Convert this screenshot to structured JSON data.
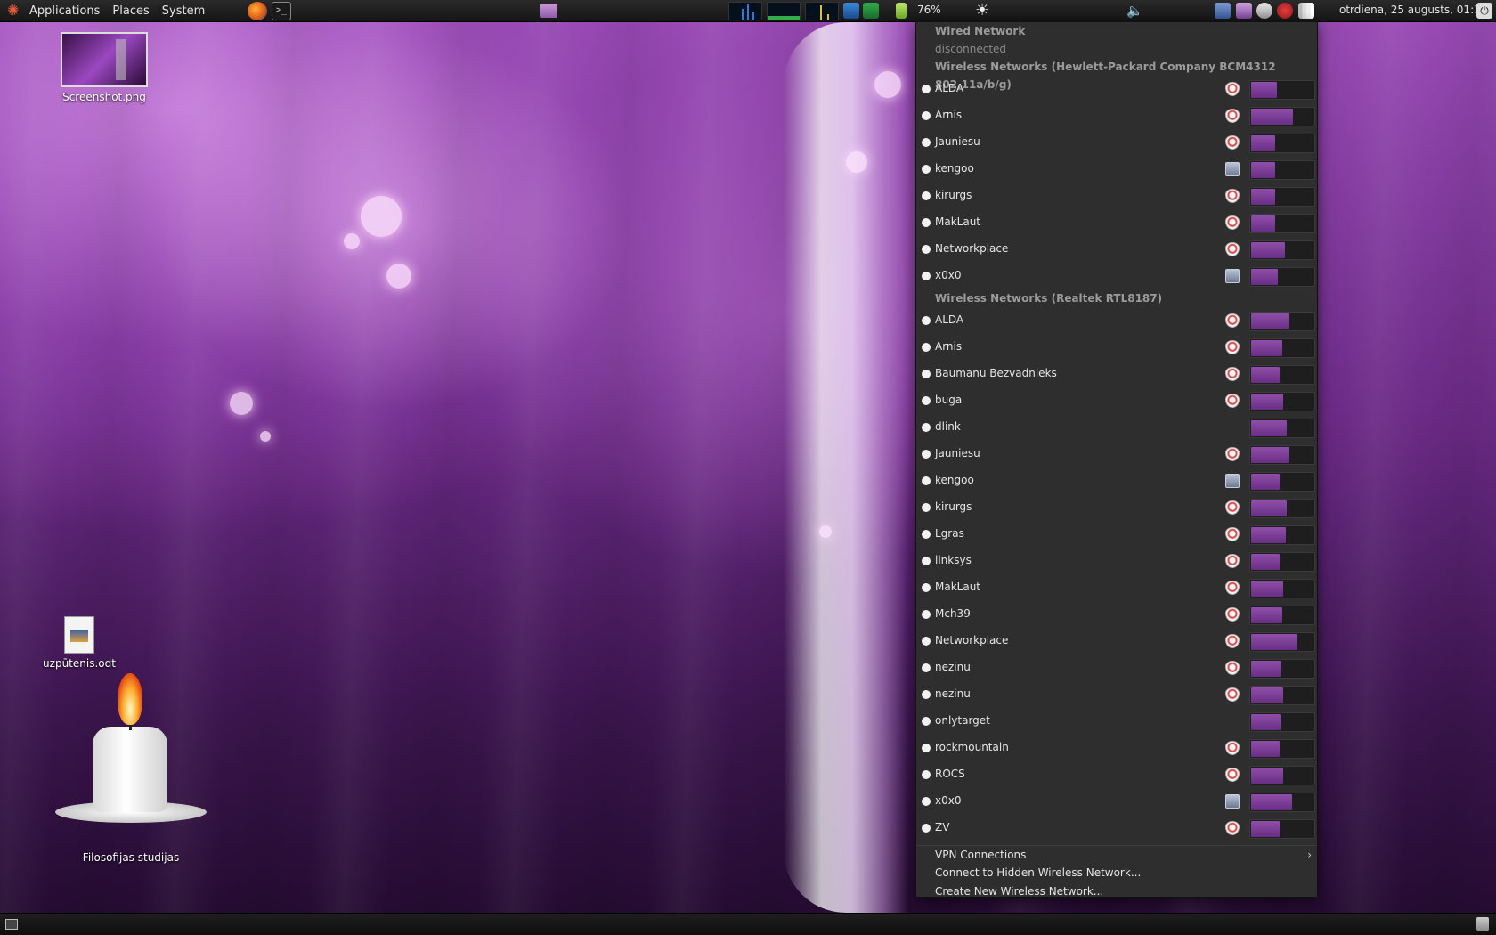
{
  "top_panel": {
    "menus": [
      "Applications",
      "Places",
      "System"
    ],
    "battery_percent": "76%",
    "clock": "otrdiena, 25 augusts, 01:12"
  },
  "desktop": {
    "icons": [
      {
        "label": "Screenshot.png"
      },
      {
        "label": "uzpūtenis.odt"
      },
      {
        "label": "Filosofijas studijas"
      }
    ]
  },
  "network_menu": {
    "wired": {
      "title": "Wired Network",
      "status": "disconnected"
    },
    "wireless_sections": [
      {
        "title": "Wireless Networks (Hewlett-Packard Company BCM4312 802.11a/b/g)",
        "networks": [
          {
            "ssid": "ALDA",
            "security": "shield-icon",
            "signal": 0.4
          },
          {
            "ssid": "Arnis",
            "security": "shield-icon",
            "signal": 0.65
          },
          {
            "ssid": "Jauniesu",
            "security": "shield-icon",
            "signal": 0.38
          },
          {
            "ssid": "kengoo",
            "security": "adhoc-icon",
            "signal": 0.38
          },
          {
            "ssid": "kirurgs",
            "security": "shield-icon",
            "signal": 0.38
          },
          {
            "ssid": "MakLaut",
            "security": "shield-icon",
            "signal": 0.38
          },
          {
            "ssid": "Networkplace",
            "security": "shield-icon",
            "signal": 0.53
          },
          {
            "ssid": "x0x0",
            "security": "adhoc-icon",
            "signal": 0.42
          }
        ]
      },
      {
        "title": "Wireless Networks (Realtek RTL8187)",
        "networks": [
          {
            "ssid": "ALDA",
            "security": "shield-icon",
            "signal": 0.58
          },
          {
            "ssid": "Arnis",
            "security": "shield-icon",
            "signal": 0.48
          },
          {
            "ssid": "Baumanu Bezvadnieks",
            "security": "shield-icon",
            "signal": 0.44
          },
          {
            "ssid": "buga",
            "security": "shield-icon",
            "signal": 0.5
          },
          {
            "ssid": "dlink",
            "security": "",
            "signal": 0.56
          },
          {
            "ssid": "Jauniesu",
            "security": "shield-icon",
            "signal": 0.6
          },
          {
            "ssid": "kengoo",
            "security": "adhoc-icon",
            "signal": 0.44
          },
          {
            "ssid": "kirurgs",
            "security": "shield-icon",
            "signal": 0.55
          },
          {
            "ssid": "Lgras",
            "security": "shield-icon",
            "signal": 0.54
          },
          {
            "ssid": "linksys",
            "security": "shield-icon",
            "signal": 0.44
          },
          {
            "ssid": "MakLaut",
            "security": "shield-icon",
            "signal": 0.5
          },
          {
            "ssid": "Mch39",
            "security": "shield-icon",
            "signal": 0.48
          },
          {
            "ssid": "Networkplace",
            "security": "shield-icon",
            "signal": 0.72
          },
          {
            "ssid": "nezinu",
            "security": "shield-icon",
            "signal": 0.46
          },
          {
            "ssid": "nezinu",
            "security": "shield-icon",
            "signal": 0.5
          },
          {
            "ssid": "onlytarget",
            "security": "",
            "signal": 0.46
          },
          {
            "ssid": "rockmountain",
            "security": "shield-icon",
            "signal": 0.44
          },
          {
            "ssid": "ROCS",
            "security": "shield-icon",
            "signal": 0.5
          },
          {
            "ssid": "x0x0",
            "security": "adhoc-icon",
            "signal": 0.64
          },
          {
            "ssid": "ZV",
            "security": "shield-icon",
            "signal": 0.44
          }
        ]
      }
    ],
    "vpn_label": "VPN Connections",
    "hidden_label": "Connect to Hidden Wireless Network...",
    "create_label": "Create New Wireless Network..."
  },
  "colors": {
    "menu_bg": "#2e2e2e",
    "signal_fill": "#8e4fa8",
    "panel_bg": "#1a1a1a"
  }
}
